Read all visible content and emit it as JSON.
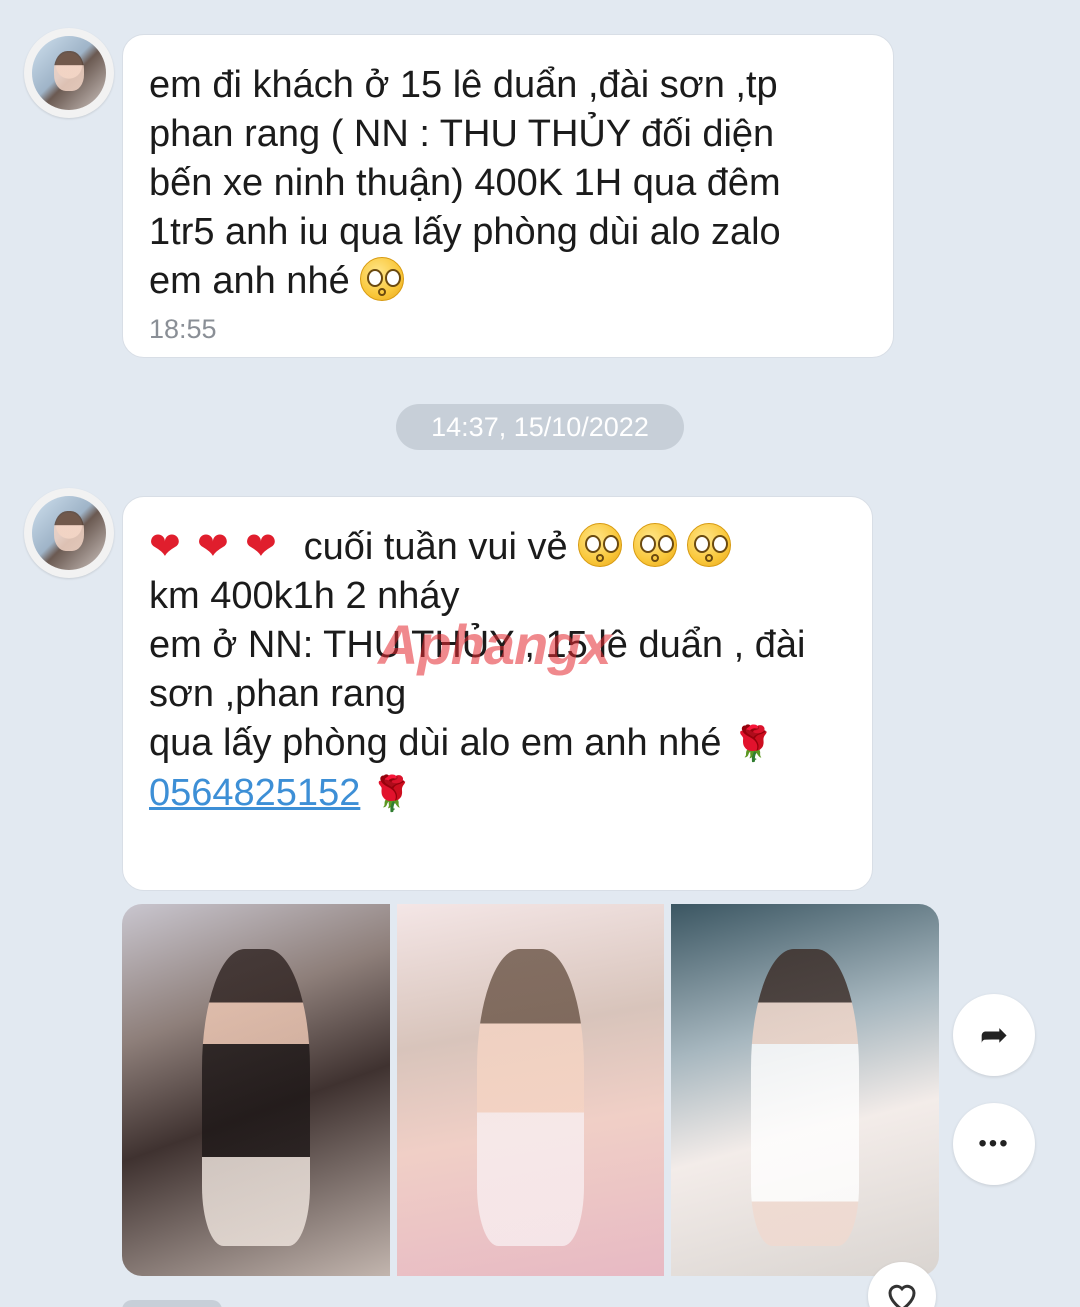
{
  "messages": [
    {
      "lines": [
        "em đi khách ở 15 lê duẩn ,đài sơn ,tp",
        "phan rang ( NN : THU THỦY  đối diện",
        "bến xe ninh thuận) 400K 1H qua đêm",
        "1tr5  anh iu qua lấy phòng dùi alo zalo",
        "em anh nhé"
      ],
      "time": "18:55"
    },
    {
      "line1": "cuối tuần vui vẻ",
      "line2": "km 400k1h 2 nháy",
      "line3": "em ở NN: THU THỦY , 15 lê duẩn , đài",
      "line4": "sơn ,phan rang",
      "line5": "qua lấy phòng dùi alo em anh nhé",
      "phone": "0564825152"
    }
  ],
  "date_divider": "14:37, 15/10/2022",
  "watermark": "Aphangx",
  "icons": {
    "heart": "heart-emoji",
    "rose": "rose-emoji",
    "kiss": "kissing-face-emoji",
    "share": "share-arrow-icon",
    "more": "more-dots-icon",
    "react": "heart-outline-icon"
  },
  "glyphs": {
    "heart": "❤",
    "rose": "🌹",
    "share": "➦",
    "more": "•••"
  },
  "colors": {
    "background": "#e2e9f1",
    "bubble": "#ffffff",
    "link": "#3d8fd6",
    "divider": "#c7cfd8"
  }
}
